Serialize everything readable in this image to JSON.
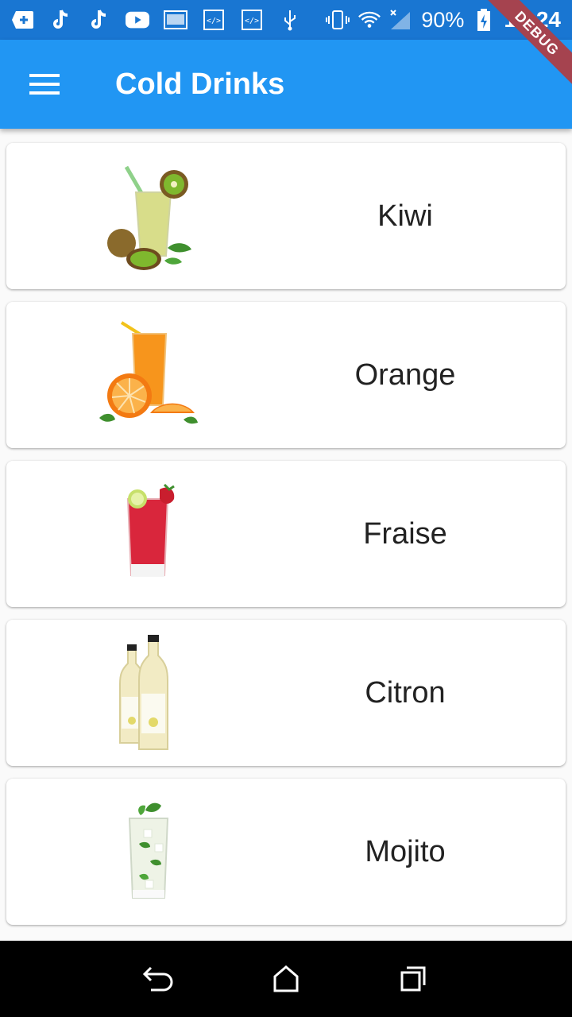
{
  "status_bar": {
    "battery": "90%",
    "time": "10:24",
    "icons": [
      "add-box-icon",
      "tiktok-icon",
      "tiktok-icon",
      "youtube-icon",
      "image-icon",
      "code-icon",
      "code-icon",
      "usb-icon",
      "vibrate-icon",
      "wifi-icon",
      "signal-icon",
      "battery-charging-icon"
    ]
  },
  "debug_banner": "DEBUG",
  "app_bar": {
    "title": "Cold Drinks",
    "menu_icon": "hamburger-menu-icon"
  },
  "drinks": [
    {
      "label": "Kiwi",
      "image": "kiwi-drink-image",
      "color": "#c9d36a",
      "accent": "#6aa82a"
    },
    {
      "label": "Orange",
      "image": "orange-drink-image",
      "color": "#f59a1b",
      "accent": "#f37a12"
    },
    {
      "label": "Fraise",
      "image": "strawberry-drink-image",
      "color": "#d9263c",
      "accent": "#9fcf3a"
    },
    {
      "label": "Citron",
      "image": "lemon-bottles-image",
      "color": "#f0e6b0",
      "accent": "#e3d96a"
    },
    {
      "label": "Mojito",
      "image": "mojito-drink-image",
      "color": "#e8f0e0",
      "accent": "#3f8f2e"
    }
  ],
  "nav_bar": {
    "back": "back-icon",
    "home": "home-icon",
    "recents": "recents-icon"
  }
}
